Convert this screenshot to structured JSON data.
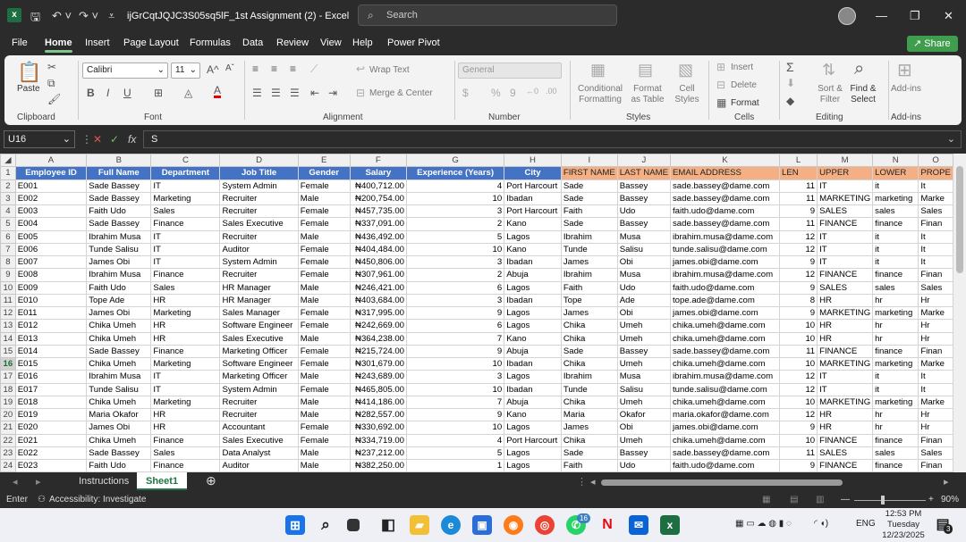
{
  "window": {
    "doc_title": "ijGrCqtJQJC3S05sq5lF_1st Assignment (2) - Excel",
    "search_placeholder": "Search",
    "share_label": "Share"
  },
  "menu": [
    "File",
    "Home",
    "Insert",
    "Page Layout",
    "Formulas",
    "Data",
    "Review",
    "View",
    "Help",
    "Power Pivot"
  ],
  "ribbon": {
    "clipboard": {
      "paste": "Paste",
      "label": "Clipboard"
    },
    "font": {
      "name": "Calibri",
      "size": "11",
      "label": "Font"
    },
    "alignment": {
      "wrap": "Wrap Text",
      "merge": "Merge & Center",
      "label": "Alignment"
    },
    "number": {
      "format": "General",
      "label": "Number"
    },
    "styles": {
      "cond": "Conditional Formatting",
      "table": "Format as Table",
      "cell": "Cell Styles",
      "label": "Styles"
    },
    "cells": {
      "insert": "Insert",
      "delete": "Delete",
      "format": "Format",
      "label": "Cells"
    },
    "editing": {
      "sort": "Sort & Filter",
      "find": "Find & Select",
      "label": "Editing"
    },
    "addins": {
      "btn": "Add-ins",
      "label": "Add-ins"
    }
  },
  "formula": {
    "namebox": "U16",
    "content": "S",
    "fx": "fx"
  },
  "columns": [
    "A",
    "B",
    "C",
    "D",
    "E",
    "F",
    "G",
    "H",
    "I",
    "J",
    "K",
    "L",
    "M",
    "N",
    "O"
  ],
  "header_row": [
    "Employee ID",
    "Full Name",
    "Department",
    "Job Title",
    "Gender",
    "Salary",
    "Experience (Years)",
    "City",
    "FIRST NAME",
    "LAST NAME",
    "EMAIL ADDRESS",
    "LEN",
    "UPPER",
    "LOWER",
    "PROPE"
  ],
  "rows": [
    [
      "E001",
      "Sade Bassey",
      "IT",
      "System Admin",
      "Female",
      "₦400,712.00",
      "4",
      "Port Harcourt",
      "Sade",
      "Bassey",
      "sade.bassey@dame.com",
      "11",
      "IT",
      "it",
      "It"
    ],
    [
      "E002",
      "Sade Bassey",
      "Marketing",
      "Recruiter",
      "Male",
      "₦200,754.00",
      "10",
      "Ibadan",
      "Sade",
      "Bassey",
      "sade.bassey@dame.com",
      "11",
      "MARKETING",
      "marketing",
      "Marke"
    ],
    [
      "E003",
      "Faith Udo",
      "Sales",
      "Recruiter",
      "Female",
      "₦457,735.00",
      "3",
      "Port Harcourt",
      "Faith",
      "Udo",
      "faith.udo@dame.com",
      "9",
      "SALES",
      "sales",
      "Sales"
    ],
    [
      "E004",
      "Sade Bassey",
      "Finance",
      "Sales Executive",
      "Female",
      "₦337,091.00",
      "2",
      "Kano",
      "Sade",
      "Bassey",
      "sade.bassey@dame.com",
      "11",
      "FINANCE",
      "finance",
      "Finan"
    ],
    [
      "E005",
      "Ibrahim Musa",
      "IT",
      "Recruiter",
      "Male",
      "₦436,492.00",
      "5",
      "Lagos",
      "Ibrahim",
      "Musa",
      "ibrahim.musa@dame.com",
      "12",
      "IT",
      "it",
      "It"
    ],
    [
      "E006",
      "Tunde Salisu",
      "IT",
      "Auditor",
      "Female",
      "₦404,484.00",
      "10",
      "Kano",
      "Tunde",
      "Salisu",
      "tunde.salisu@dame.com",
      "12",
      "IT",
      "it",
      "It"
    ],
    [
      "E007",
      "James Obi",
      "IT",
      "System Admin",
      "Female",
      "₦450,806.00",
      "3",
      "Ibadan",
      "James",
      "Obi",
      "james.obi@dame.com",
      "9",
      "IT",
      "it",
      "It"
    ],
    [
      "E008",
      "Ibrahim Musa",
      "Finance",
      "Recruiter",
      "Female",
      "₦307,961.00",
      "2",
      "Abuja",
      "Ibrahim",
      "Musa",
      "ibrahim.musa@dame.com",
      "12",
      "FINANCE",
      "finance",
      "Finan"
    ],
    [
      "E009",
      "Faith Udo",
      "Sales",
      "HR Manager",
      "Male",
      "₦246,421.00",
      "6",
      "Lagos",
      "Faith",
      "Udo",
      "faith.udo@dame.com",
      "9",
      "SALES",
      "sales",
      "Sales"
    ],
    [
      "E010",
      "Tope Ade",
      "HR",
      "HR Manager",
      "Male",
      "₦403,684.00",
      "3",
      "Ibadan",
      "Tope",
      "Ade",
      "tope.ade@dame.com",
      "8",
      "HR",
      "hr",
      "Hr"
    ],
    [
      "E011",
      "James Obi",
      "Marketing",
      "Sales Manager",
      "Female",
      "₦317,995.00",
      "9",
      "Lagos",
      "James",
      "Obi",
      "james.obi@dame.com",
      "9",
      "MARKETING",
      "marketing",
      "Marke"
    ],
    [
      "E012",
      "Chika Umeh",
      "HR",
      "Software Engineer",
      "Female",
      "₦242,669.00",
      "6",
      "Lagos",
      "Chika",
      "Umeh",
      "chika.umeh@dame.com",
      "10",
      "HR",
      "hr",
      "Hr"
    ],
    [
      "E013",
      "Chika Umeh",
      "HR",
      "Sales Executive",
      "Male",
      "₦364,238.00",
      "7",
      "Kano",
      "Chika",
      "Umeh",
      "chika.umeh@dame.com",
      "10",
      "HR",
      "hr",
      "Hr"
    ],
    [
      "E014",
      "Sade Bassey",
      "Finance",
      "Marketing Officer",
      "Female",
      "₦215,724.00",
      "9",
      "Abuja",
      "Sade",
      "Bassey",
      "sade.bassey@dame.com",
      "11",
      "FINANCE",
      "finance",
      "Finan"
    ],
    [
      "E015",
      "Chika Umeh",
      "Marketing",
      "Software Engineer",
      "Female",
      "₦301,679.00",
      "10",
      "Ibadan",
      "Chika",
      "Umeh",
      "chika.umeh@dame.com",
      "10",
      "MARKETING",
      "marketing",
      "Marke"
    ],
    [
      "E016",
      "Ibrahim Musa",
      "IT",
      "Marketing Officer",
      "Male",
      "₦243,689.00",
      "3",
      "Lagos",
      "Ibrahim",
      "Musa",
      "ibrahim.musa@dame.com",
      "12",
      "IT",
      "it",
      "It"
    ],
    [
      "E017",
      "Tunde Salisu",
      "IT",
      "System Admin",
      "Female",
      "₦465,805.00",
      "10",
      "Ibadan",
      "Tunde",
      "Salisu",
      "tunde.salisu@dame.com",
      "12",
      "IT",
      "it",
      "It"
    ],
    [
      "E018",
      "Chika Umeh",
      "Marketing",
      "Recruiter",
      "Male",
      "₦414,186.00",
      "7",
      "Abuja",
      "Chika",
      "Umeh",
      "chika.umeh@dame.com",
      "10",
      "MARKETING",
      "marketing",
      "Marke"
    ],
    [
      "E019",
      "Maria Okafor",
      "HR",
      "Recruiter",
      "Male",
      "₦282,557.00",
      "9",
      "Kano",
      "Maria",
      "Okafor",
      "maria.okafor@dame.com",
      "12",
      "HR",
      "hr",
      "Hr"
    ],
    [
      "E020",
      "James Obi",
      "HR",
      "Accountant",
      "Female",
      "₦330,692.00",
      "10",
      "Lagos",
      "James",
      "Obi",
      "james.obi@dame.com",
      "9",
      "HR",
      "hr",
      "Hr"
    ],
    [
      "E021",
      "Chika Umeh",
      "Finance",
      "Sales Executive",
      "Female",
      "₦334,719.00",
      "4",
      "Port Harcourt",
      "Chika",
      "Umeh",
      "chika.umeh@dame.com",
      "10",
      "FINANCE",
      "finance",
      "Finan"
    ],
    [
      "E022",
      "Sade Bassey",
      "Sales",
      "Data Analyst",
      "Male",
      "₦237,212.00",
      "5",
      "Lagos",
      "Sade",
      "Bassey",
      "sade.bassey@dame.com",
      "11",
      "SALES",
      "sales",
      "Sales"
    ],
    [
      "E023",
      "Faith Udo",
      "Finance",
      "Auditor",
      "Male",
      "₦382,250.00",
      "1",
      "Lagos",
      "Faith",
      "Udo",
      "faith.udo@dame.com",
      "9",
      "FINANCE",
      "finance",
      "Finan"
    ]
  ],
  "sheets": [
    "Instructions",
    "Sheet1"
  ],
  "status": {
    "mode": "Enter",
    "accessibility": "Accessibility: Investigate",
    "zoom": "90%"
  },
  "taskbar": {
    "time": "12:53 PM",
    "day": "Tuesday",
    "date": "12/23/2025",
    "lang": "ENG",
    "whatsapp_badge": "16"
  }
}
